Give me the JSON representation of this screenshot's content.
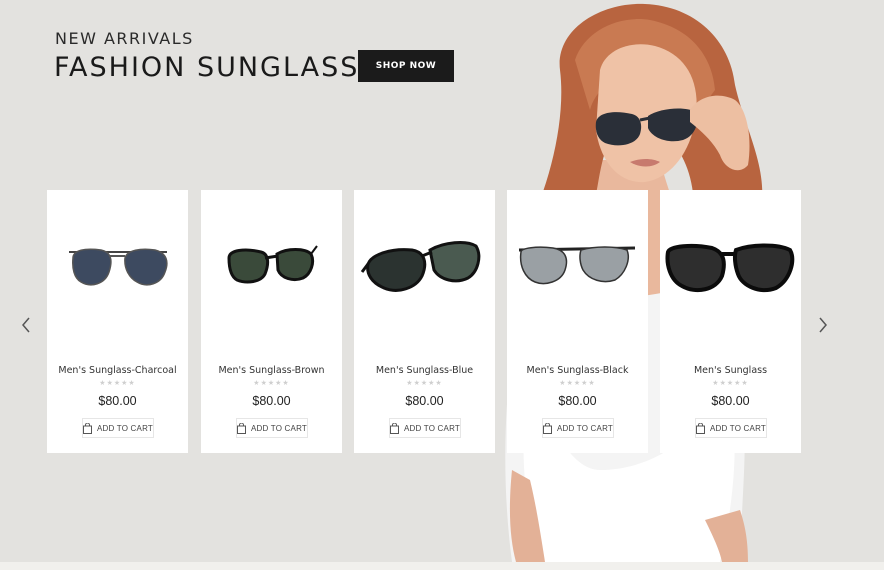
{
  "hero": {
    "eyebrow": "NEW ARRIVALS",
    "title": "FASHION SUNGLASSES",
    "cta_label": "SHOP NOW"
  },
  "carousel": {
    "prev_icon": "chevron-left-icon",
    "next_icon": "chevron-right-icon",
    "products": [
      {
        "name": "Men's Sunglass-Charcoal",
        "price": "$80.00",
        "rating": 0,
        "cart_label": "ADD TO CART"
      },
      {
        "name": "Men's Sunglass-Brown",
        "price": "$80.00",
        "rating": 0,
        "cart_label": "ADD TO CART"
      },
      {
        "name": "Men's Sunglass-Blue",
        "price": "$80.00",
        "rating": 0,
        "cart_label": "ADD TO CART"
      },
      {
        "name": "Men's Sunglass-Black",
        "price": "$80.00",
        "rating": 0,
        "cart_label": "ADD TO CART"
      },
      {
        "name": "Men's Sunglass",
        "price": "$80.00",
        "rating": 0,
        "cart_label": "ADD TO CART"
      }
    ]
  },
  "colors": {
    "background": "#e3e2df",
    "button": "#1b1b1b",
    "star_empty": "#cfcfcf"
  }
}
